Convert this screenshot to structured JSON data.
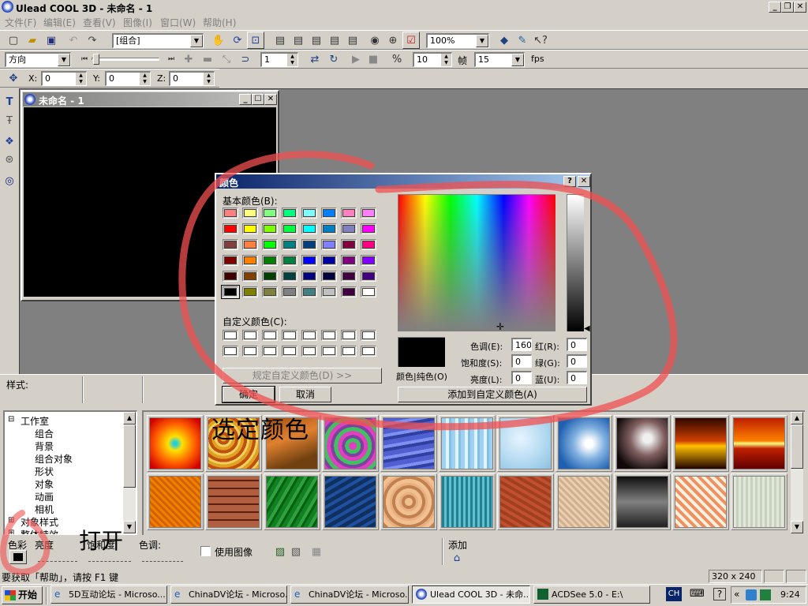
{
  "app": {
    "title": "Ulead COOL 3D - 未命名 - 1"
  },
  "menu": [
    "文件(F)",
    "编辑(E)",
    "查看(V)",
    "图像(I)",
    "窗口(W)",
    "帮助(H)"
  ],
  "toolbar1": {
    "object_combo": "[组合]",
    "zoom_combo": "100%"
  },
  "toolbar2": {
    "direction_combo": "方向",
    "frame_value": "1",
    "fps_value": "10",
    "frame_label": "帧",
    "frames_combo": "15",
    "fps_label": "fps"
  },
  "toolbar3": {
    "x_label": "X:",
    "x_value": "0",
    "y_label": "Y:",
    "y_value": "0",
    "z_label": "Z:",
    "z_value": "0"
  },
  "doc_window": {
    "title": "未命名 - 1"
  },
  "style_label": "样式:",
  "tree": {
    "root": "工作室",
    "children": [
      "组合",
      "背景",
      "组合对象",
      "形状",
      "对象",
      "动画",
      "相机"
    ],
    "extra": [
      "对象样式",
      "整体特效"
    ]
  },
  "bottom_panel": {
    "color_label": "色彩",
    "brightness_label": "亮度",
    "saturation_label": "饱和度",
    "hue_label": "色调:",
    "use_image_label": "使用图像",
    "add_label": "添加"
  },
  "annotations": {
    "select_color": "选定颜色",
    "open": "打开"
  },
  "status": {
    "help_text": "要获取「帮助」，请按 F1 键",
    "size": "320 x 240"
  },
  "color_dialog": {
    "title": "颜色",
    "basic_colors_label": "基本颜色(B):",
    "custom_colors_label": "自定义颜色(C):",
    "define_custom_button": "规定自定义颜色(D) >>",
    "ok_button": "确定",
    "cancel_button": "取消",
    "color_solid_label": "颜色|纯色(O)",
    "hue_label": "色调(E):",
    "hue_value": "160",
    "sat_label": "饱和度(S):",
    "sat_value": "0",
    "lum_label": "亮度(L):",
    "lum_value": "0",
    "red_label": "红(R):",
    "red_value": "0",
    "green_label": "绿(G):",
    "green_value": "0",
    "blue_label": "蓝(U):",
    "blue_value": "0",
    "add_custom_button": "添加到自定义颜色(A)",
    "basic_colors": [
      "#ff8080",
      "#ffff80",
      "#80ff80",
      "#00ff80",
      "#80ffff",
      "#0080ff",
      "#ff80c0",
      "#ff80ff",
      "#ff0000",
      "#ffff00",
      "#80ff00",
      "#00ff40",
      "#00ffff",
      "#0080c0",
      "#8080c0",
      "#ff00ff",
      "#804040",
      "#ff8040",
      "#00ff00",
      "#008080",
      "#004080",
      "#8080ff",
      "#800040",
      "#ff0080",
      "#800000",
      "#ff8000",
      "#008000",
      "#008040",
      "#0000ff",
      "#0000a0",
      "#800080",
      "#8000ff",
      "#400000",
      "#804000",
      "#004000",
      "#004040",
      "#000080",
      "#000040",
      "#400040",
      "#400080",
      "#000000",
      "#808000",
      "#808040",
      "#808080",
      "#408080",
      "#c0c0c0",
      "#400040",
      "#ffffff"
    ]
  },
  "taskbar": {
    "start": "开始",
    "items": [
      "5D互动论坛 - Microso...",
      "ChinaDV论坛 - Microso...",
      "ChinaDV论坛 - Microso...",
      "Ulead COOL 3D - 未命...",
      "ACDSee 5.0 - E:\\"
    ],
    "lang": "CH",
    "time": "9:24"
  }
}
